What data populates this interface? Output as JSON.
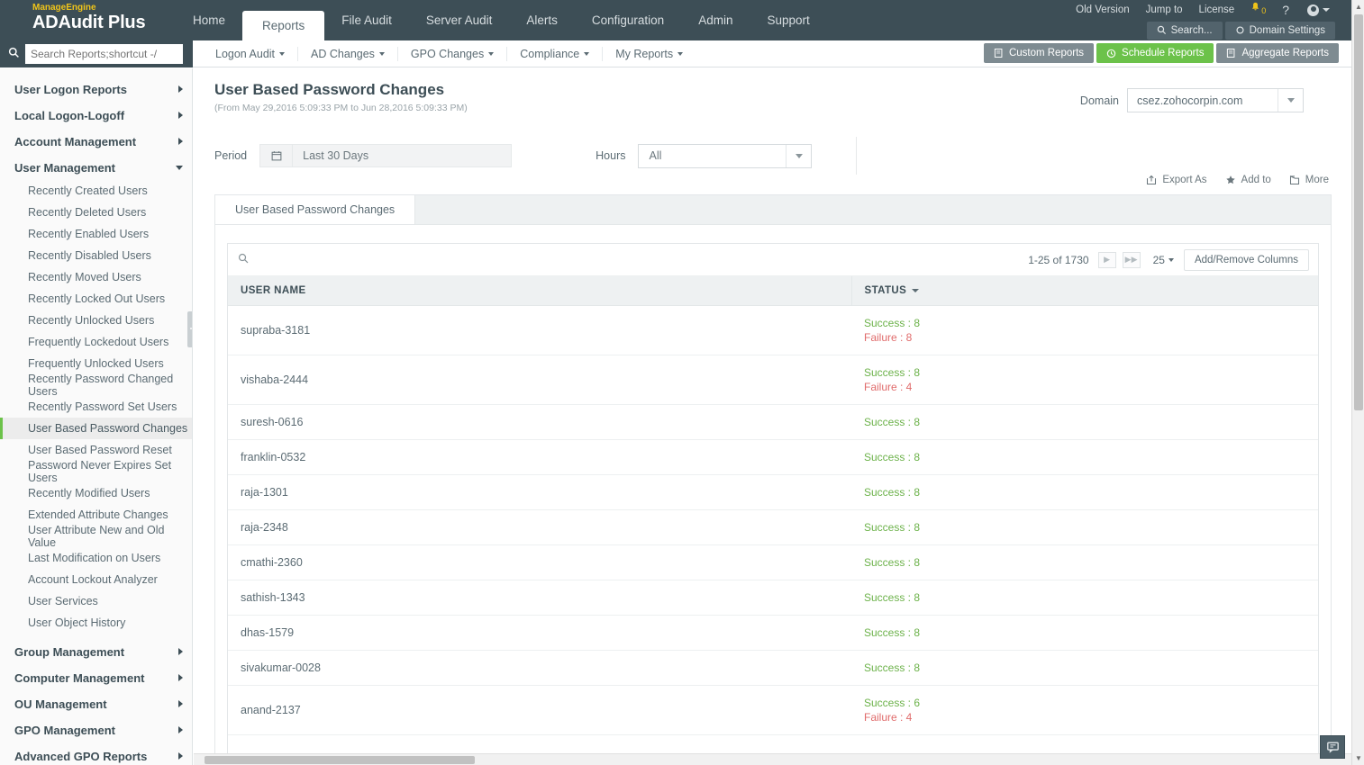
{
  "header": {
    "brand_prefix": "ManageEngine",
    "brand_name": "ADAudit Plus",
    "nav": [
      {
        "label": "Home",
        "active": false
      },
      {
        "label": "Reports",
        "active": true
      },
      {
        "label": "File Audit",
        "active": false
      },
      {
        "label": "Server Audit",
        "active": false
      },
      {
        "label": "Alerts",
        "active": false
      },
      {
        "label": "Configuration",
        "active": false
      },
      {
        "label": "Admin",
        "active": false
      },
      {
        "label": "Support",
        "active": false
      }
    ],
    "utility": [
      {
        "label": "Old Version"
      },
      {
        "label": "Jump to"
      },
      {
        "label": "License"
      }
    ],
    "notification_count": "0",
    "help_label": "?",
    "search_pill": "Search...",
    "domain_settings_pill": "Domain Settings"
  },
  "secondbar": {
    "search_placeholder": "Search Reports;shortcut -/",
    "menus": [
      {
        "label": "Logon Audit"
      },
      {
        "label": "AD Changes"
      },
      {
        "label": "GPO Changes"
      },
      {
        "label": "Compliance"
      },
      {
        "label": "My Reports"
      }
    ],
    "buttons": [
      {
        "label": "Custom Reports",
        "style": "grey"
      },
      {
        "label": "Schedule Reports",
        "style": "green"
      },
      {
        "label": "Aggregate Reports",
        "style": "grey"
      }
    ],
    "accent_green": "#6cc24a"
  },
  "sidebar": {
    "groups": [
      {
        "label": "User Logon Reports",
        "expanded": false
      },
      {
        "label": "Local Logon-Logoff",
        "expanded": false
      },
      {
        "label": "Account Management",
        "expanded": false
      },
      {
        "label": "User Management",
        "expanded": true
      }
    ],
    "user_management_items": [
      {
        "label": "Recently Created Users",
        "selected": false
      },
      {
        "label": "Recently Deleted Users",
        "selected": false
      },
      {
        "label": "Recently Enabled Users",
        "selected": false
      },
      {
        "label": "Recently Disabled Users",
        "selected": false
      },
      {
        "label": "Recently Moved Users",
        "selected": false
      },
      {
        "label": "Recently Locked Out Users",
        "selected": false
      },
      {
        "label": "Recently Unlocked Users",
        "selected": false
      },
      {
        "label": "Frequently Lockedout Users",
        "selected": false
      },
      {
        "label": "Frequently Unlocked Users",
        "selected": false
      },
      {
        "label": "Recently Password Changed Users",
        "selected": false
      },
      {
        "label": "Recently Password Set Users",
        "selected": false
      },
      {
        "label": "User Based Password Changes",
        "selected": true
      },
      {
        "label": "User Based Password Reset",
        "selected": false
      },
      {
        "label": "Password Never Expires Set Users",
        "selected": false
      },
      {
        "label": "Recently Modified Users",
        "selected": false
      },
      {
        "label": "Extended Attribute Changes",
        "selected": false
      },
      {
        "label": "User Attribute New and Old Value",
        "selected": false
      },
      {
        "label": "Last Modification on Users",
        "selected": false
      },
      {
        "label": "Account Lockout Analyzer",
        "selected": false
      },
      {
        "label": "User Services",
        "selected": false
      },
      {
        "label": "User Object History",
        "selected": false
      }
    ],
    "bottom_groups": [
      {
        "label": "Group Management"
      },
      {
        "label": "Computer Management"
      },
      {
        "label": "OU Management"
      },
      {
        "label": "GPO Management"
      },
      {
        "label": "Advanced GPO Reports"
      }
    ]
  },
  "page": {
    "title": "User Based Password Changes",
    "subtitle": "(From May 29,2016 5:09:33 PM to Jun 28,2016 5:09:33 PM)",
    "domain_label": "Domain",
    "domain_value": "csez.zohocorpin.com",
    "period_label": "Period",
    "period_value": "Last 30 Days",
    "hours_label": "Hours",
    "hours_value": "All",
    "actions": [
      {
        "label": "Export As",
        "icon": "export-icon"
      },
      {
        "label": "Add to",
        "icon": "star-icon"
      },
      {
        "label": "More",
        "icon": "more-icon"
      }
    ],
    "report_tab": "User Based Password Changes"
  },
  "table": {
    "pagination_info": "1-25 of 1730",
    "page_size": "25",
    "add_remove_columns": "Add/Remove Columns",
    "columns": [
      "USER NAME",
      "STATUS"
    ],
    "rows": [
      {
        "user": "supraba-3181",
        "success": "Success : 8",
        "failure": "Failure : 8"
      },
      {
        "user": "vishaba-2444",
        "success": "Success : 8",
        "failure": "Failure : 4"
      },
      {
        "user": "suresh-0616",
        "success": "Success : 8",
        "failure": ""
      },
      {
        "user": "franklin-0532",
        "success": "Success : 8",
        "failure": ""
      },
      {
        "user": "raja-1301",
        "success": "Success : 8",
        "failure": ""
      },
      {
        "user": "raja-2348",
        "success": "Success : 8",
        "failure": ""
      },
      {
        "user": "cmathi-2360",
        "success": "Success : 8",
        "failure": ""
      },
      {
        "user": "sathish-1343",
        "success": "Success : 8",
        "failure": ""
      },
      {
        "user": "dhas-1579",
        "success": "Success : 8",
        "failure": ""
      },
      {
        "user": "sivakumar-0028",
        "success": "Success : 8",
        "failure": ""
      },
      {
        "user": "anand-2137",
        "success": "Success : 6",
        "failure": "Failure : 4"
      }
    ],
    "success_color": "#6cb24a",
    "failure_color": "#e06b6b"
  }
}
